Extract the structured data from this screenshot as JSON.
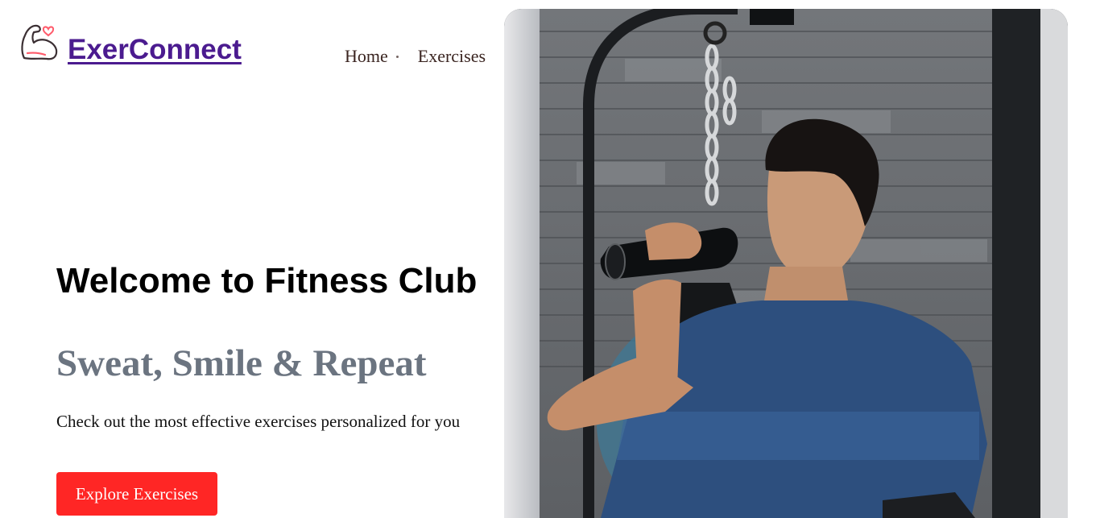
{
  "brand": {
    "name": "ExerConnect"
  },
  "nav": {
    "items": [
      {
        "label": "Home"
      },
      {
        "label": "Exercises"
      }
    ]
  },
  "hero": {
    "title": "Welcome to Fitness Club",
    "subtitle": "Sweat, Smile & Repeat",
    "description": "Check out the most effective exercises personalized for you",
    "cta_label": "Explore Exercises"
  },
  "colors": {
    "brand": "#4b1b8f",
    "accent": "#ff2625",
    "subtitle": "#6b7480"
  },
  "icons": {
    "logo": "flexed-arm-heart-icon"
  }
}
